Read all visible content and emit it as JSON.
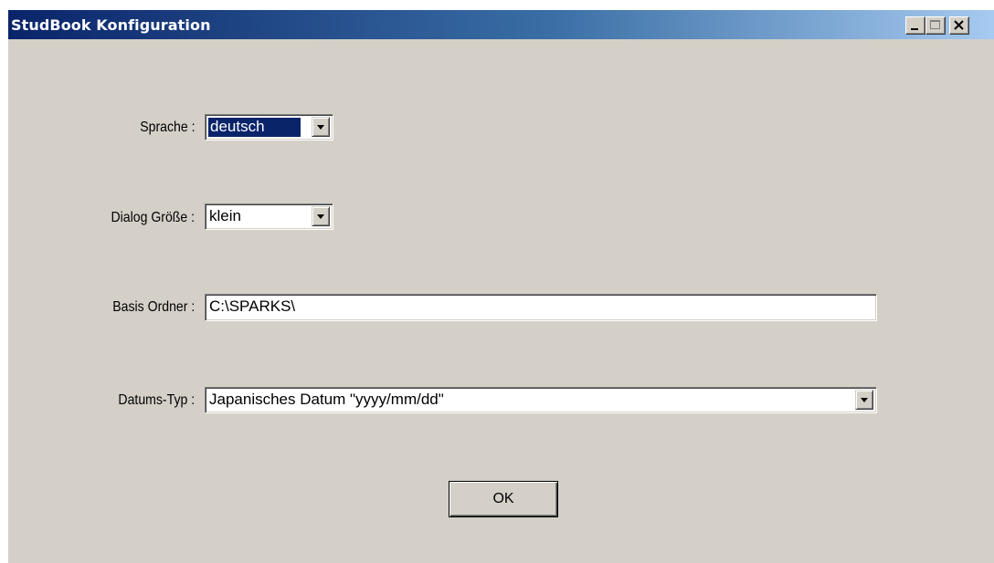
{
  "window": {
    "title": "StudBook Konfiguration",
    "controls": {
      "minimize": "minimize-icon",
      "maximize": "maximize-icon",
      "close": "close-icon"
    }
  },
  "form": {
    "language": {
      "label": "Sprache :",
      "value": "deutsch"
    },
    "dialog_size": {
      "label": "Dialog Größe :",
      "value": "klein"
    },
    "base_folder": {
      "label": "Basis Ordner :",
      "value": "C:\\SPARKS\\"
    },
    "date_type": {
      "label": "Datums-Typ :",
      "value": "Japanisches Datum \"yyyy/mm/dd\""
    }
  },
  "ok_label": "OK",
  "colors": {
    "title_gradient_start": "#0a246a",
    "title_gradient_end": "#a6caf0",
    "dialog_face": "#d4d0c8",
    "selection": "#0a246a"
  }
}
